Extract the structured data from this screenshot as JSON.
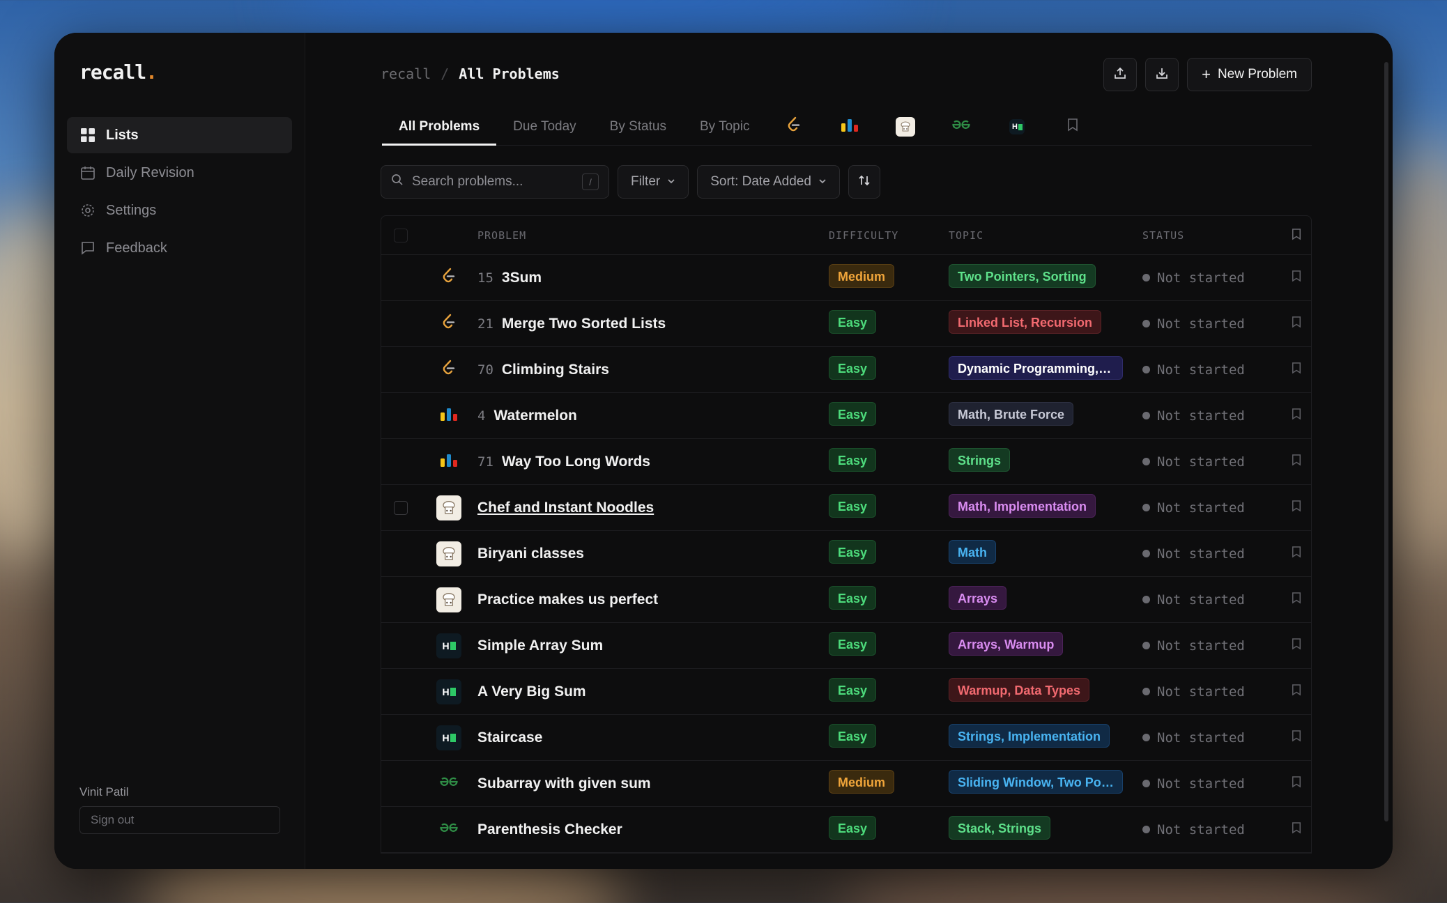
{
  "app": {
    "logo": "recall",
    "logo_dot": "."
  },
  "sidebar": {
    "items": [
      {
        "label": "Lists",
        "icon": "grid-icon",
        "active": true
      },
      {
        "label": "Daily Revision",
        "icon": "calendar-icon",
        "active": false
      },
      {
        "label": "Settings",
        "icon": "gear-icon",
        "active": false
      },
      {
        "label": "Feedback",
        "icon": "message-icon",
        "active": false
      }
    ],
    "user_name": "Vinit Patil",
    "sign_out": "Sign out"
  },
  "breadcrumb": {
    "root": "recall",
    "sep": "/",
    "current": "All Problems"
  },
  "actions": {
    "new_problem": "New Problem",
    "plus": "+"
  },
  "tabs": [
    {
      "label": "All Problems",
      "active": true
    },
    {
      "label": "Due Today"
    },
    {
      "label": "By Status"
    },
    {
      "label": "By Topic"
    }
  ],
  "toolbar": {
    "search_placeholder": "Search problems...",
    "search_shortcut": "/",
    "filter": "Filter",
    "sort": "Sort: Date Added"
  },
  "table": {
    "headers": {
      "problem": "PROBLEM",
      "difficulty": "DIFFICULTY",
      "topic": "TOPIC",
      "status": "STATUS"
    },
    "rows": [
      {
        "source": "leetcode",
        "num": "15",
        "title": "3Sum",
        "difficulty": "Medium",
        "topic": "Two Pointers, Sorting",
        "topic_color": "green",
        "status": "Not started"
      },
      {
        "source": "leetcode",
        "num": "21",
        "title": "Merge Two Sorted Lists",
        "difficulty": "Easy",
        "topic": "Linked List, Recursion",
        "topic_color": "red",
        "status": "Not started"
      },
      {
        "source": "leetcode",
        "num": "70",
        "title": "Climbing Stairs",
        "difficulty": "Easy",
        "topic": "Dynamic Programming, …",
        "topic_color": "indigo",
        "status": "Not started"
      },
      {
        "source": "codeforces",
        "num": "4",
        "title": "Watermelon",
        "difficulty": "Easy",
        "topic": "Math, Brute Force",
        "topic_color": "slate",
        "status": "Not started"
      },
      {
        "source": "codeforces",
        "num": "71",
        "title": "Way Too Long Words",
        "difficulty": "Easy",
        "topic": "Strings",
        "topic_color": "green",
        "status": "Not started"
      },
      {
        "source": "codechef",
        "num": "",
        "title": "Chef and Instant Noodles",
        "difficulty": "Easy",
        "topic": "Math, Implementation",
        "topic_color": "purple",
        "status": "Not started",
        "hover": true
      },
      {
        "source": "codechef",
        "num": "",
        "title": "Biryani classes",
        "difficulty": "Easy",
        "topic": "Math",
        "topic_color": "blue",
        "status": "Not started"
      },
      {
        "source": "codechef",
        "num": "",
        "title": "Practice makes us perfect",
        "difficulty": "Easy",
        "topic": "Arrays",
        "topic_color": "purple",
        "status": "Not started"
      },
      {
        "source": "hackerrank",
        "num": "",
        "title": "Simple Array Sum",
        "difficulty": "Easy",
        "topic": "Arrays, Warmup",
        "topic_color": "purple",
        "status": "Not started"
      },
      {
        "source": "hackerrank",
        "num": "",
        "title": "A Very Big Sum",
        "difficulty": "Easy",
        "topic": "Warmup, Data Types",
        "topic_color": "red",
        "status": "Not started"
      },
      {
        "source": "hackerrank",
        "num": "",
        "title": "Staircase",
        "difficulty": "Easy",
        "topic": "Strings, Implementation",
        "topic_color": "blue",
        "status": "Not started"
      },
      {
        "source": "geeksforgeeks",
        "num": "",
        "title": "Subarray with given sum",
        "difficulty": "Medium",
        "topic": "Sliding Window, Two Poi…",
        "topic_color": "blue",
        "status": "Not started"
      },
      {
        "source": "geeksforgeeks",
        "num": "",
        "title": "Parenthesis Checker",
        "difficulty": "Easy",
        "topic": "Stack, Strings",
        "topic_color": "green",
        "status": "Not started"
      }
    ]
  }
}
